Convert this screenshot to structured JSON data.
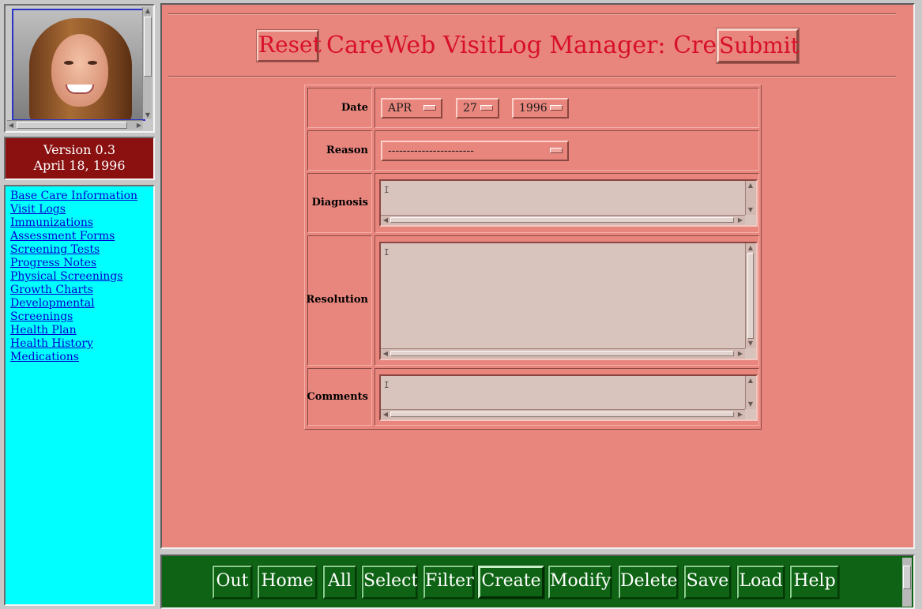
{
  "sidebar": {
    "version": "Version 0.3",
    "date": "April 18, 1996",
    "nav_links": [
      "Base Care Information",
      "Visit Logs",
      "Immunizations",
      "Assessment Forms",
      "Screening Tests",
      "Progress Notes",
      "Physical Screenings",
      "Growth Charts",
      "Developmental",
      "Screenings",
      "Health Plan",
      "Health History",
      "Medications"
    ]
  },
  "header": {
    "reset_label": "Reset",
    "title": "CareWeb VisitLog Manager: Create",
    "submit_label": "Submit"
  },
  "form": {
    "date_label": "Date",
    "month": "APR",
    "day": "27",
    "year": "1996",
    "reason_label": "Reason",
    "reason_value": "-----------------------",
    "diagnosis_label": "Diagnosis",
    "resolution_label": "Resolution",
    "comments_label": "Comments"
  },
  "toolbar": {
    "buttons": [
      "Out",
      "Home",
      "All",
      "Select",
      "Filter",
      "Create",
      "Modify",
      "Delete",
      "Save",
      "Load",
      "Help"
    ],
    "active": "Create"
  },
  "colors": {
    "main_bg": "#e8867e",
    "nav_bg": "#00ffff",
    "version_bg": "#8b1010",
    "toolbar_bg": "#0e6414",
    "title_red": "#d8102a"
  }
}
